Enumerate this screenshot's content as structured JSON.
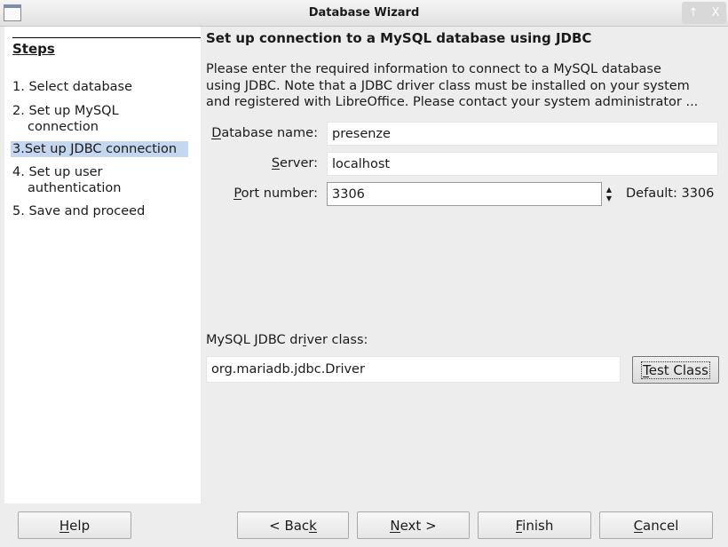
{
  "window": {
    "title": "Database Wizard",
    "controls": [
      "↑",
      "X"
    ]
  },
  "sidebar": {
    "heading": "Steps",
    "steps": [
      {
        "num": "1.",
        "label": "Select database",
        "selected": false
      },
      {
        "num": "2.",
        "label": "Set up MySQL connection",
        "selected": false
      },
      {
        "num": "3.",
        "label": "Set up JDBC connection",
        "selected": true
      },
      {
        "num": "4.",
        "label": "Set up user authentication",
        "selected": false
      },
      {
        "num": "5.",
        "label": "Save and proceed",
        "selected": false
      }
    ],
    "selected_color": "#c5d7ef"
  },
  "main": {
    "title": "Set up connection to a MySQL database using JDBC",
    "description": [
      "Please enter the required information to connect to a MySQL database",
      "using JDBC. Note that a JDBC driver class must be installed on your system",
      "and registered with LibreOffice. Please contact your system administrator ..."
    ],
    "database_name": {
      "label": "Database name:",
      "mnemonic": 0,
      "value": "presenze"
    },
    "server": {
      "label": "Server:",
      "mnemonic": 0,
      "value": "localhost"
    },
    "port": {
      "label": "Port number:",
      "mnemonic": 0,
      "value": "3306",
      "default_text": "Default: 3306"
    },
    "driver": {
      "label": "MySQL JDBC driver class:",
      "mnemonic": 13,
      "value": "org.mariadb.jdbc.Driver"
    },
    "test_class": {
      "label": "Test Class",
      "mnemonic": 0
    }
  },
  "footer": {
    "help": {
      "label": "Help",
      "mnemonic": 0
    },
    "back": {
      "label": "< Back",
      "mnemonic": 5
    },
    "next": {
      "label": "Next >",
      "mnemonic": 0
    },
    "finish": {
      "label": "Finish",
      "mnemonic": 0
    },
    "cancel": {
      "label": "Cancel",
      "mnemonic": 0
    }
  }
}
